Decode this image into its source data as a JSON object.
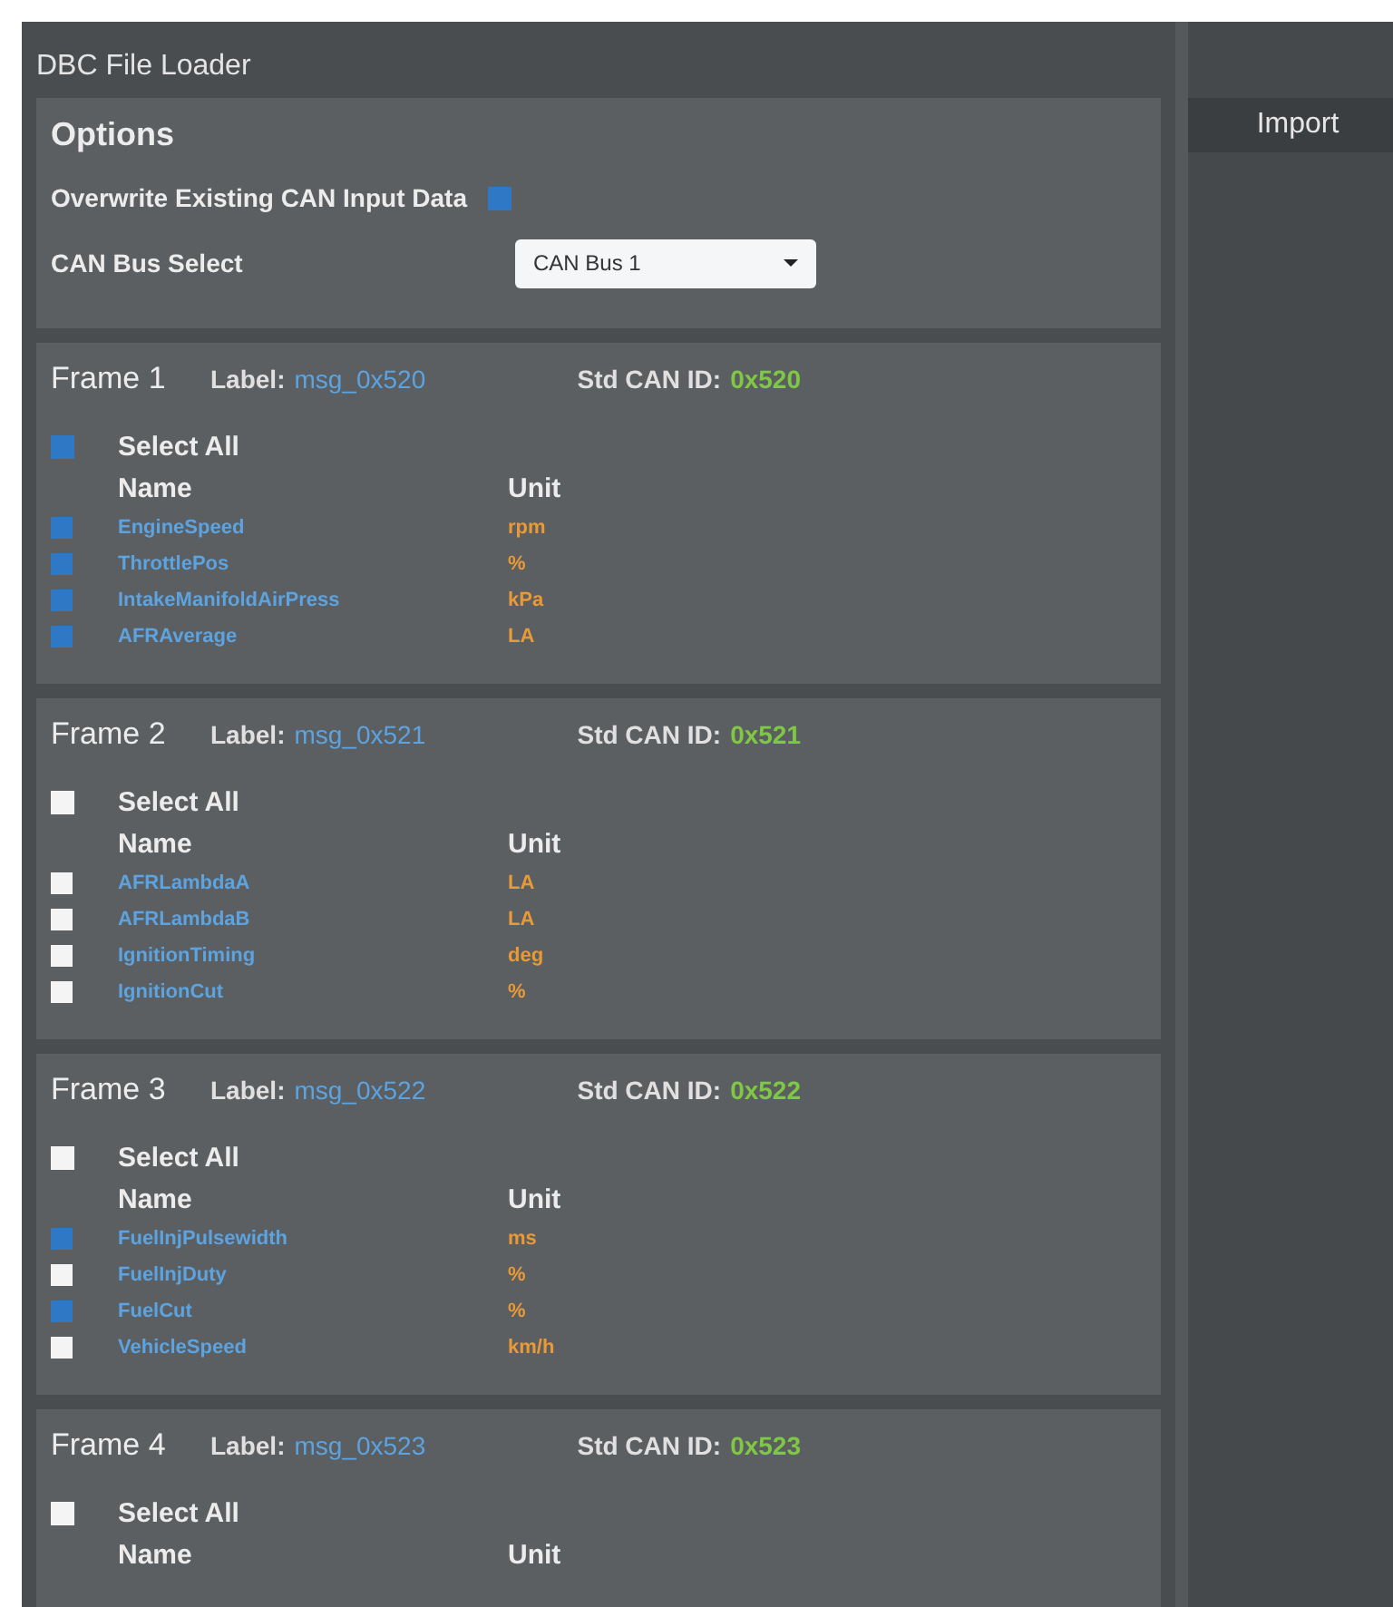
{
  "window": {
    "title": "DBC File Loader"
  },
  "import_button": "Import",
  "options": {
    "title": "Options",
    "overwrite": {
      "label": "Overwrite Existing CAN Input Data",
      "checked": true
    },
    "bus_select": {
      "label": "CAN Bus Select",
      "value": "CAN Bus 1"
    }
  },
  "frames": [
    {
      "title": "Frame 1",
      "label_caption": "Label:",
      "label": "msg_0x520",
      "id_caption": "Std CAN ID:",
      "id": "0x520",
      "select_all": {
        "label": "Select All",
        "checked": true
      },
      "columns": [
        "Name",
        "Unit"
      ],
      "signals": [
        {
          "name": "EngineSpeed",
          "unit": "rpm",
          "checked": true
        },
        {
          "name": "ThrottlePos",
          "unit": "%",
          "checked": true
        },
        {
          "name": "IntakeManifoldAirPress",
          "unit": "kPa",
          "checked": true
        },
        {
          "name": "AFRAverage",
          "unit": "LA",
          "checked": true
        }
      ]
    },
    {
      "title": "Frame 2",
      "label_caption": "Label:",
      "label": "msg_0x521",
      "id_caption": "Std CAN ID:",
      "id": "0x521",
      "select_all": {
        "label": "Select All",
        "checked": false
      },
      "columns": [
        "Name",
        "Unit"
      ],
      "signals": [
        {
          "name": "AFRLambdaA",
          "unit": "LA",
          "checked": false
        },
        {
          "name": "AFRLambdaB",
          "unit": "LA",
          "checked": false
        },
        {
          "name": "IgnitionTiming",
          "unit": "deg",
          "checked": false
        },
        {
          "name": "IgnitionCut",
          "unit": "%",
          "checked": false
        }
      ]
    },
    {
      "title": "Frame 3",
      "label_caption": "Label:",
      "label": "msg_0x522",
      "id_caption": "Std CAN ID:",
      "id": "0x522",
      "select_all": {
        "label": "Select All",
        "checked": false
      },
      "columns": [
        "Name",
        "Unit"
      ],
      "signals": [
        {
          "name": "FuelInjPulsewidth",
          "unit": "ms",
          "checked": true
        },
        {
          "name": "FuelInjDuty",
          "unit": "%",
          "checked": false
        },
        {
          "name": "FuelCut",
          "unit": "%",
          "checked": true
        },
        {
          "name": "VehicleSpeed",
          "unit": "km/h",
          "checked": false
        }
      ]
    },
    {
      "title": "Frame 4",
      "label_caption": "Label:",
      "label": "msg_0x523",
      "id_caption": "Std CAN ID:",
      "id": "0x523",
      "select_all": {
        "label": "Select All",
        "checked": false
      },
      "columns": [
        "Name",
        "Unit"
      ]
    }
  ]
}
